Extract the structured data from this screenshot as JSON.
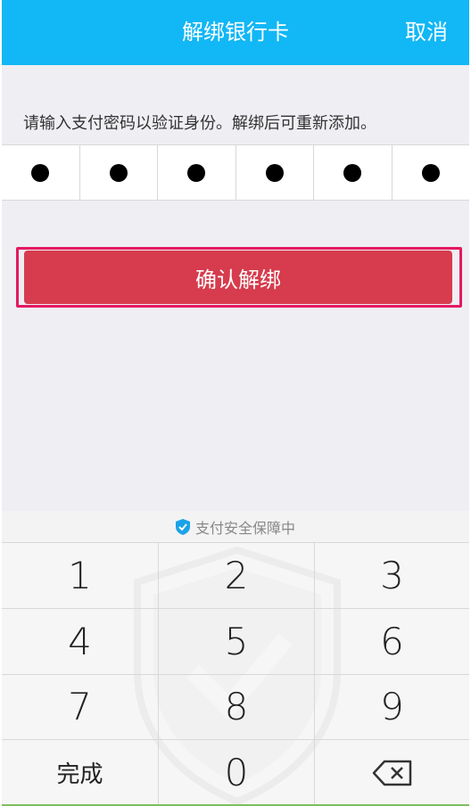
{
  "header": {
    "title": "解绑银行卡",
    "cancel": "取消"
  },
  "hint": "请输入支付密码以验证身份。解绑后可重新添加。",
  "password": {
    "length": 6,
    "filled": 6
  },
  "confirm_button": "确认解绑",
  "keyboard": {
    "security_text": "支付安全保障中",
    "keys": [
      "1",
      "2",
      "3",
      "4",
      "5",
      "6",
      "7",
      "8",
      "9",
      "完成",
      "0",
      ""
    ]
  },
  "colors": {
    "header": "#12b7f5",
    "confirm": "#d63c4d",
    "highlight": "#e5195f"
  }
}
